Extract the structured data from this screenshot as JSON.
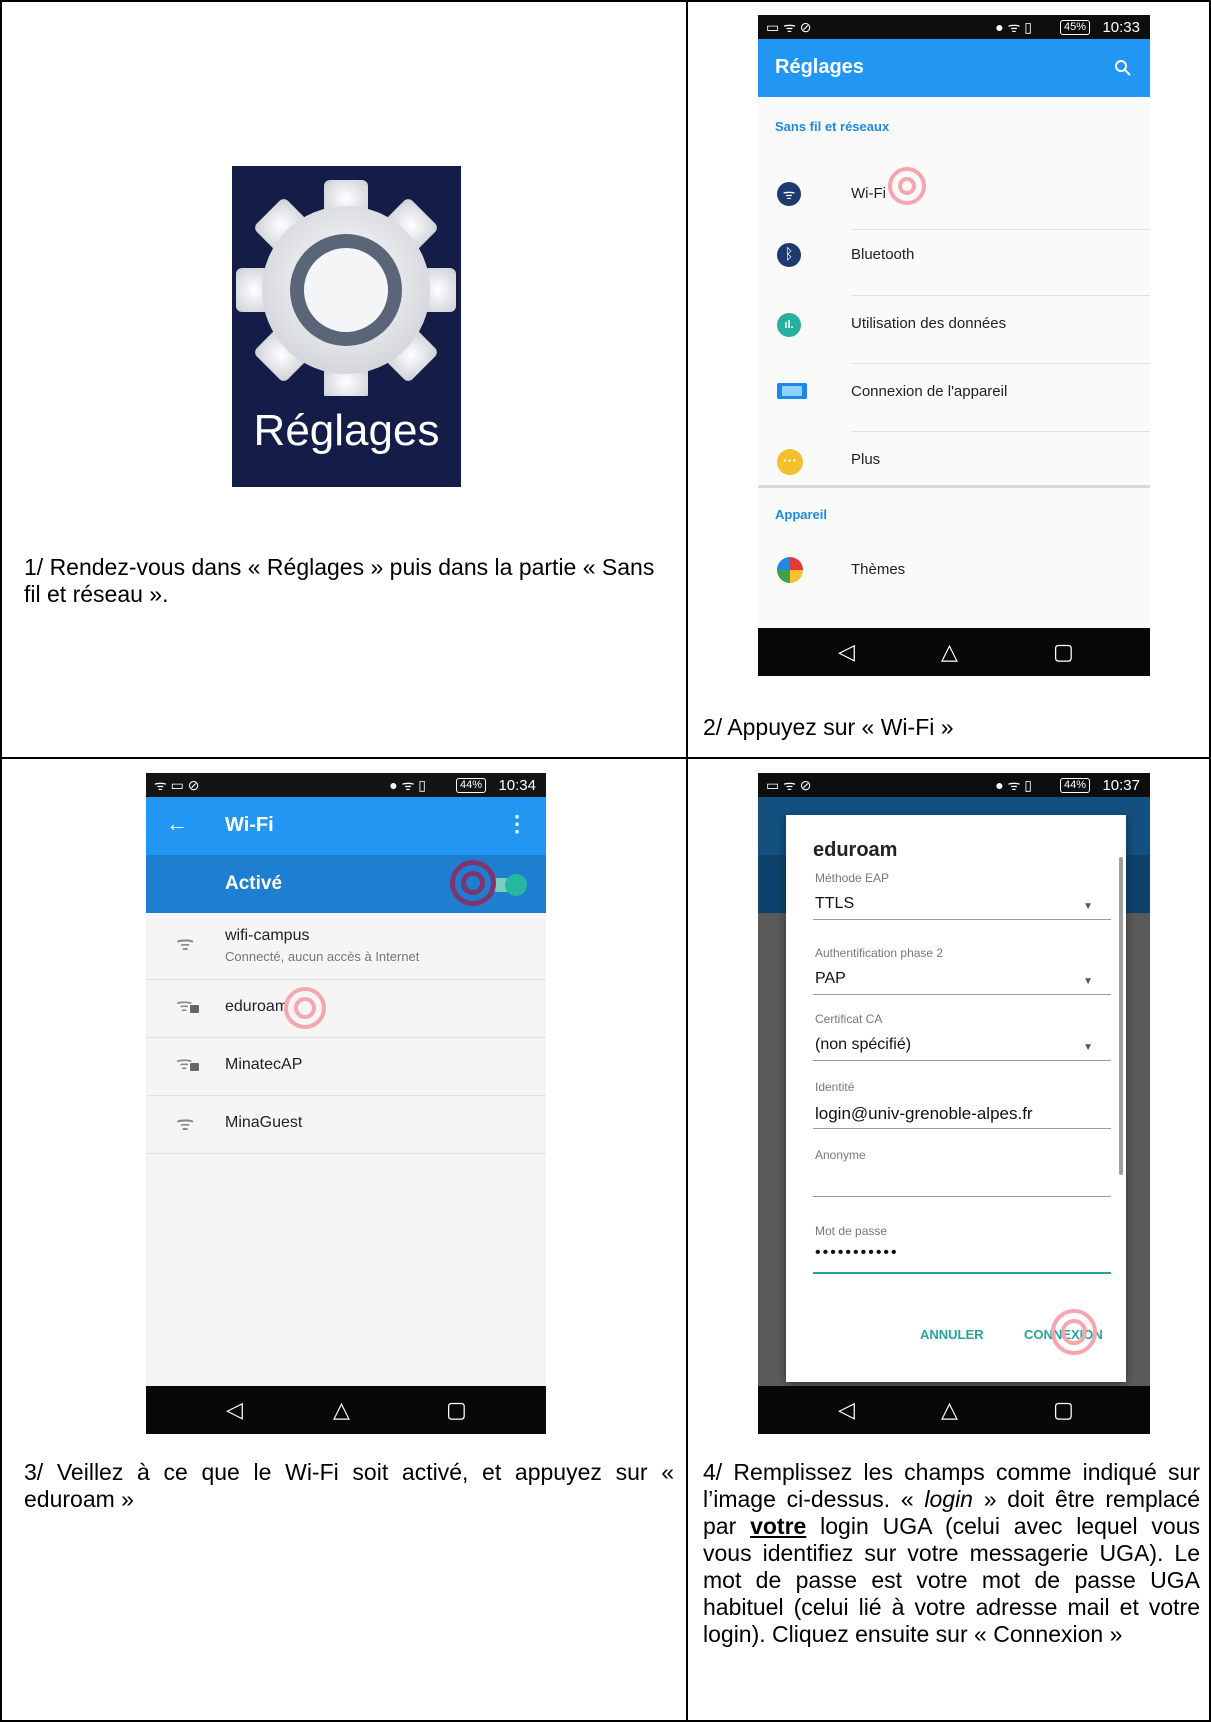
{
  "step1": {
    "icon_label": "Réglages",
    "caption": "1/ Rendez-vous dans « Réglages » puis dans la partie « Sans fil et réseau »."
  },
  "step2": {
    "status": {
      "battery": "45%",
      "time": "10:33"
    },
    "appbar_title": "Réglages",
    "section1": "Sans fil et réseaux",
    "items": [
      {
        "label": "Wi-Fi",
        "icon": "wifi-icon",
        "color": "#1e3a6e"
      },
      {
        "label": "Bluetooth",
        "icon": "bluetooth-icon",
        "color": "#1e3a6e"
      },
      {
        "label": "Utilisation des données",
        "icon": "data-usage-icon",
        "color": "#26b0a0"
      },
      {
        "label": "Connexion de l'appareil",
        "icon": "device-connection-icon",
        "color": "#1e88e5"
      },
      {
        "label": "Plus",
        "icon": "more-icon",
        "color": "#f3c02b"
      }
    ],
    "section2": "Appareil",
    "item_themes": "Thèmes",
    "caption": "2/ Appuyez sur « Wi-Fi »"
  },
  "step3": {
    "status": {
      "battery": "44%",
      "time": "10:34"
    },
    "appbar_title": "Wi-Fi",
    "toggle_label": "Activé",
    "networks": [
      {
        "name": "wifi-campus",
        "sub": "Connecté, aucun accès à Internet",
        "locked": false
      },
      {
        "name": "eduroam",
        "sub": "",
        "locked": true
      },
      {
        "name": "MinatecAP",
        "sub": "",
        "locked": true
      },
      {
        "name": "MinaGuest",
        "sub": "",
        "locked": false
      }
    ],
    "caption": "3/ Veillez à ce que le Wi-Fi soit activé, et appuyez sur « eduroam »"
  },
  "step4": {
    "status": {
      "battery": "44%",
      "time": "10:37"
    },
    "dialog_title": "eduroam",
    "fields": [
      {
        "label": "Méthode EAP",
        "value": "TTLS",
        "dropdown": true
      },
      {
        "label": "Authentification phase 2",
        "value": "PAP",
        "dropdown": true
      },
      {
        "label": "Certificat CA",
        "value": "(non spécifié)",
        "dropdown": true
      },
      {
        "label": "Identité",
        "value": "login@univ-grenoble-alpes.fr",
        "dropdown": false
      },
      {
        "label": "Anonyme",
        "value": "",
        "dropdown": false
      },
      {
        "label": "Mot de passe",
        "value": "•••••••••••",
        "dropdown": false
      }
    ],
    "cancel": "ANNULER",
    "connect": "CONNEXION",
    "caption_1": "4/ Remplissez les champs comme indiqué sur l’image ci-dessus. « ",
    "caption_login": "login",
    "caption_2": " » doit être remplacé par ",
    "caption_votre": "votre",
    "caption_3": " login UGA (celui avec lequel vous vous identifiez sur votre messagerie UGA). Le mot de passe est votre mot de passe UGA habituel (celui lié à votre adresse mail et votre login). Cliquez ensuite sur « Connexion »"
  }
}
